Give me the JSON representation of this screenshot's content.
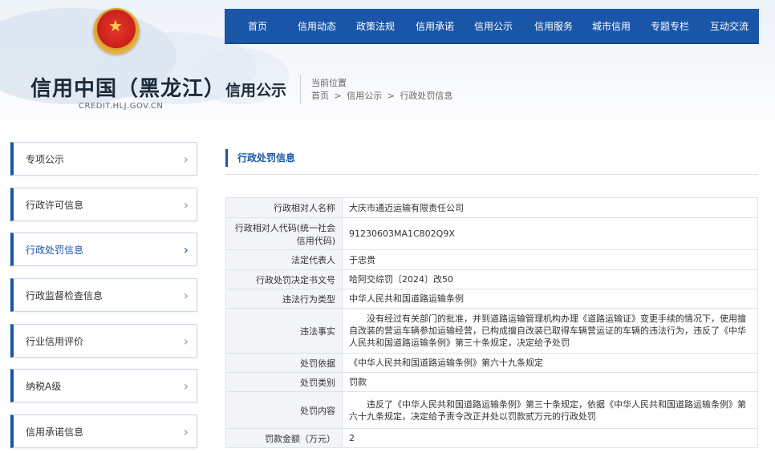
{
  "site": {
    "title": "信用中国（黑龙江）",
    "domain": "CREDIT.HLJ.GOV.CN"
  },
  "nav": [
    "首页",
    "信用动态",
    "政策法规",
    "信用承诺",
    "信用公示",
    "信用服务",
    "城市信用",
    "专题专栏",
    "互动交流"
  ],
  "section_title": "信用公示",
  "location": {
    "label": "当前位置",
    "crumbs": [
      "首页",
      ">",
      "信用公示",
      ">",
      "行政处罚信息"
    ]
  },
  "sidebar": {
    "items": [
      {
        "label": "专项公示"
      },
      {
        "label": "行政许可信息"
      },
      {
        "label": "行政处罚信息"
      },
      {
        "label": "行政监督检查信息"
      },
      {
        "label": "行业信用评价"
      },
      {
        "label": "纳税A级"
      },
      {
        "label": "信用承诺信息"
      }
    ],
    "active_index": 2
  },
  "main": {
    "heading": "行政处罚信息",
    "rows": [
      {
        "k": "行政相对人名称",
        "v": "大庆市通迈运输有限责任公司"
      },
      {
        "k": "行政相对人代码(统一社会信用代码)",
        "v": "91230603MA1C802Q9X"
      },
      {
        "k": "法定代表人",
        "v": "于忠贵"
      },
      {
        "k": "行政处罚决定书文号",
        "v": "哈阿交综罚〔2024〕改50"
      },
      {
        "k": "违法行为类型",
        "v": "中华人民共和国道路运输条例"
      },
      {
        "k": "违法事实",
        "v": "没有经过有关部门的批准，并到道路运输管理机构办理《道路运输证》变更手续的情况下，使用擅自改装的营运车辆参加运输经营，已构成擅自改装已取得车辆营运证的车辆的违法行为，违反了《中华人民共和国道路运输条例》第三十条规定，决定给予处罚"
      },
      {
        "k": "处罚依据",
        "v": "《中华人民共和国道路运输条例》第六十九条规定"
      },
      {
        "k": "处罚类别",
        "v": "罚款"
      },
      {
        "k": "处罚内容",
        "v": "违反了《中华人民共和国道路运输条例》第三十条规定，依据《中华人民共和国道路运输条例》第六十九条规定，决定给予责令改正并处以罚款贰万元的行政处罚"
      },
      {
        "k": "罚款金额（万元）",
        "v": "2"
      }
    ]
  },
  "colors": {
    "primary": "#1a56a8",
    "key_cell_bg": "#f3f5f8"
  }
}
